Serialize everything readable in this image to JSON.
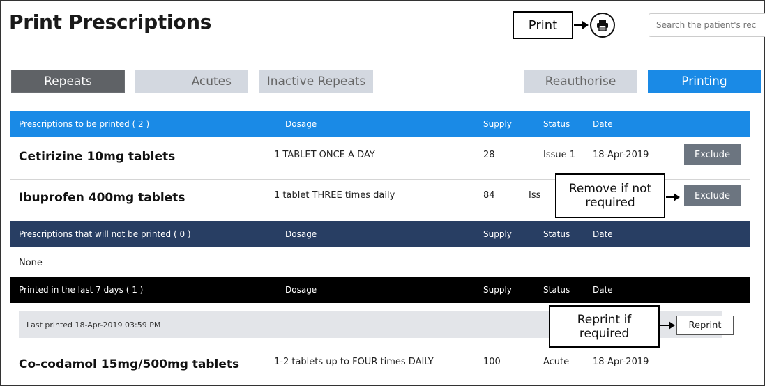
{
  "page": {
    "title": "Print Prescriptions"
  },
  "callouts": {
    "print": "Print",
    "exclude_line1": "Remove if not",
    "exclude_line2": "required",
    "reprint_line1": "Reprint if",
    "reprint_line2": "required"
  },
  "search": {
    "placeholder": "Search the patient's rec"
  },
  "tabs": {
    "repeats": "Repeats",
    "acutes": "Acutes",
    "inactive": "Inactive Repeats",
    "reauthorise": "Reauthorise",
    "printing": "Printing"
  },
  "columns": {
    "dosage": "Dosage",
    "supply": "Supply",
    "status": "Status",
    "date": "Date"
  },
  "sections": {
    "to_print": "Prescriptions to be printed  ( 2 )",
    "not_printed": "Prescriptions that will not be printed  ( 0 )",
    "printed_recent": "Printed in the last 7 days ( 1 )"
  },
  "to_print_rows": [
    {
      "drug": "Cetirizine 10mg tablets",
      "dosage": "1 TABLET ONCE A DAY",
      "supply": "28",
      "status": "Issue 1",
      "date": "18-Apr-2019",
      "action": "Exclude"
    },
    {
      "drug": "Ibuprofen 400mg tablets",
      "dosage": "1 tablet THREE times daily",
      "supply": "84",
      "status": "Iss",
      "date": "",
      "action": "Exclude"
    }
  ],
  "not_printed_empty": "None",
  "last_printed": {
    "label": "Last printed 18-Apr-2019 03:59 PM",
    "action": "Reprint"
  },
  "printed_rows": [
    {
      "drug": "Co-codamol 15mg/500mg tablets",
      "dosage": "1-2 tablets up to FOUR times DAILY",
      "supply": "100",
      "status": "Acute",
      "date": "18-Apr-2019"
    }
  ],
  "colors": {
    "accent": "#1a8ae6",
    "navy": "#283e63",
    "active_tab": "#5f6266",
    "inactive_tab": "#d3d8e0"
  },
  "icons": {
    "printer": "printer-icon"
  }
}
